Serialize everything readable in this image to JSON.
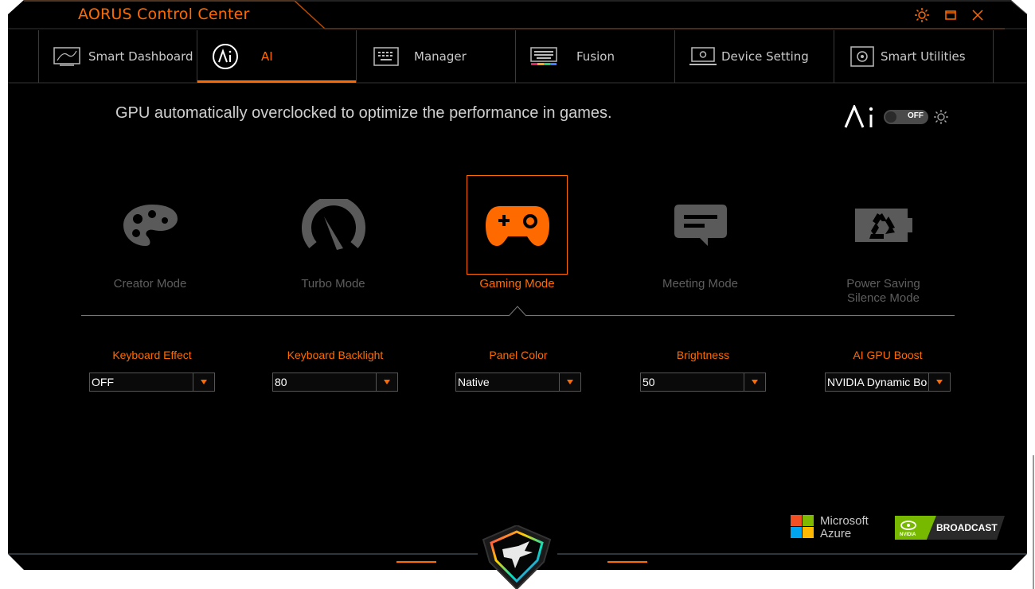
{
  "app": {
    "title": "AORUS Control Center"
  },
  "window_controls": [
    "brightness-icon",
    "restore-icon",
    "close-icon"
  ],
  "tabs": [
    {
      "label": "Smart Dashboard",
      "icon": "dashboard-icon",
      "active": false
    },
    {
      "label": "AI",
      "icon": "ai-circle-icon",
      "active": true
    },
    {
      "label": "Manager",
      "icon": "keyboard-grid-icon",
      "active": false
    },
    {
      "label": "Fusion",
      "icon": "rgb-keyboard-icon",
      "active": false
    },
    {
      "label": "Device Setting",
      "icon": "monitor-gear-icon",
      "active": false
    },
    {
      "label": "Smart Utilities",
      "icon": "utilities-icon",
      "active": false
    }
  ],
  "main": {
    "description": "GPU automatically overclocked to optimize the performance in games.",
    "ai_toggle": {
      "state": "OFF"
    }
  },
  "modes": [
    {
      "label": "Creator Mode",
      "icon": "palette-icon",
      "active": false
    },
    {
      "label": "Turbo Mode",
      "icon": "speedometer-icon",
      "active": false
    },
    {
      "label": "Gaming Mode",
      "icon": "gamepad-icon",
      "active": true
    },
    {
      "label": "Meeting Mode",
      "icon": "chat-bubble-icon",
      "active": false
    },
    {
      "label": "Power Saving\nSilence Mode",
      "icon": "recycle-battery-icon",
      "active": false
    }
  ],
  "settings": [
    {
      "label": "Keyboard Effect",
      "value": "OFF"
    },
    {
      "label": "Keyboard Backlight",
      "value": "80"
    },
    {
      "label": "Panel Color",
      "value": "Native"
    },
    {
      "label": "Brightness",
      "value": "50"
    },
    {
      "label": "AI GPU Boost",
      "value": "NVIDIA Dynamic Boost"
    }
  ],
  "partners": {
    "azure_line1": "Microsoft",
    "azure_line2": "Azure",
    "nvidia_badge": "BROADCAST",
    "nvidia_small": "NVIDIA"
  },
  "colors": {
    "accent": "#ff6a00",
    "background": "#000000",
    "inactive": "#5e5e5e"
  }
}
